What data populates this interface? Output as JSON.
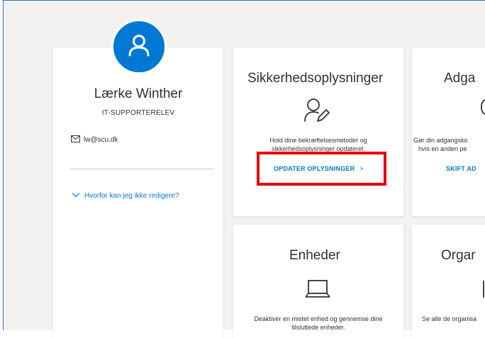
{
  "profile": {
    "name": "Lærke Winther",
    "role": "IT-SUPPORTERELEV",
    "email": "lw@scu.dk",
    "why_link": "Hvorfor kan jeg ikke redigere?"
  },
  "cards": {
    "security": {
      "title": "Sikkerhedsoplysninger",
      "desc_line1": "Hold dine bekræftelsesmetoder og",
      "desc_line2": "sikkerhedsoplysninger opdateret.",
      "link": "OPDATER OPLYSNINGER",
      "link_chevron": ">"
    },
    "password": {
      "title": "Adga",
      "desc_line1": "Gør din adgangsko",
      "desc_line2": "hvis en anden pe",
      "link": "SKIFT AD"
    },
    "devices": {
      "title": "Enheder",
      "desc_line1": "Deaktiver en mistet enhed og gennemse dine",
      "desc_line2": "tilsluttede enheder."
    },
    "organizations": {
      "title": "Orgar",
      "desc_line1": "Se alle de organisa"
    }
  },
  "colors": {
    "accent": "#0078d4",
    "highlight": "#e8000b",
    "background": "#f3f2f1"
  },
  "icons": [
    "user-icon",
    "mail-icon",
    "chevron-down-icon",
    "person-edit-icon",
    "key-icon",
    "laptop-icon",
    "organization-icon",
    "chevron-right-icon"
  ]
}
